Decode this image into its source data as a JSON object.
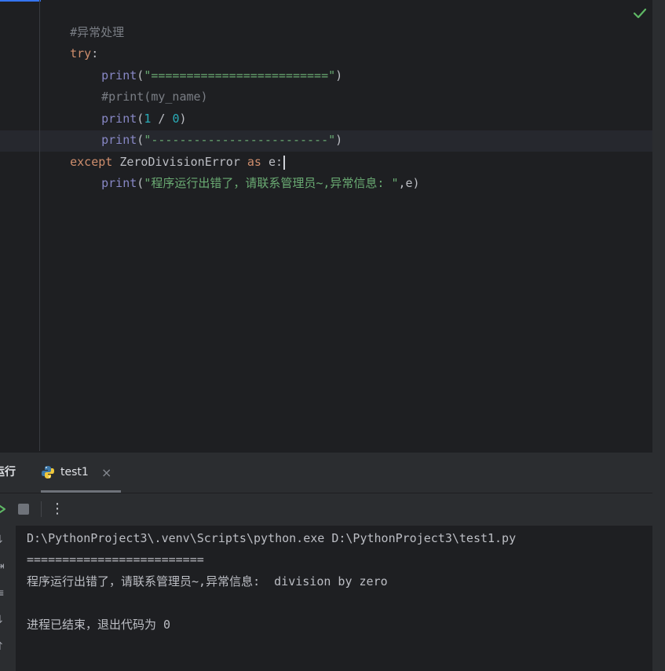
{
  "editor": {
    "lines": {
      "l1": {
        "comment": "#异常处理"
      },
      "l2": {
        "keyword": "try",
        "colon": ":"
      },
      "l3": {
        "func": "print",
        "open": "(",
        "string": "\"=========================\"",
        "close": ")"
      },
      "l4": {
        "comment": "#print(my_name)"
      },
      "l5": {
        "func": "print",
        "open": "(",
        "num1": "1",
        "op": " / ",
        "num2": "0",
        "close": ")"
      },
      "l6": {
        "func": "print",
        "open": "(",
        "string": "\"-------------------------\"",
        "close": ")"
      },
      "l7": {
        "kw_except": "except",
        "exc": " ZeroDivisionError ",
        "kw_as": "as",
        "var": " e:"
      },
      "l8": {
        "func": "print",
        "open": "(",
        "string": "\"程序运行出错了，请联系管理员~,异常信息: \"",
        "rest": ",e)"
      }
    },
    "status_icon": "checkmark-icon"
  },
  "run_panel": {
    "title": "运行",
    "tab_label": "test1",
    "tab_icon": "python-icon",
    "close_glyph": "×",
    "more_glyph": "⋮"
  },
  "console": {
    "lines": [
      "D:\\PythonProject3\\.venv\\Scripts\\python.exe D:\\PythonProject3\\test1.py",
      "=========================",
      "程序运行出错了，请联系管理员~,异常信息:  division by zero",
      "",
      "进程已结束，退出代码为 0"
    ],
    "gutter_glyphs": [
      "↓",
      "⇥",
      "≡",
      "↓",
      "↑"
    ]
  },
  "colors": {
    "background": "#1e1f22",
    "keyword": "#cf8e6d",
    "string": "#6aab73",
    "number": "#2aacb8",
    "builtin": "#8888c6",
    "comment": "#7a7e85",
    "success": "#5fb865"
  }
}
